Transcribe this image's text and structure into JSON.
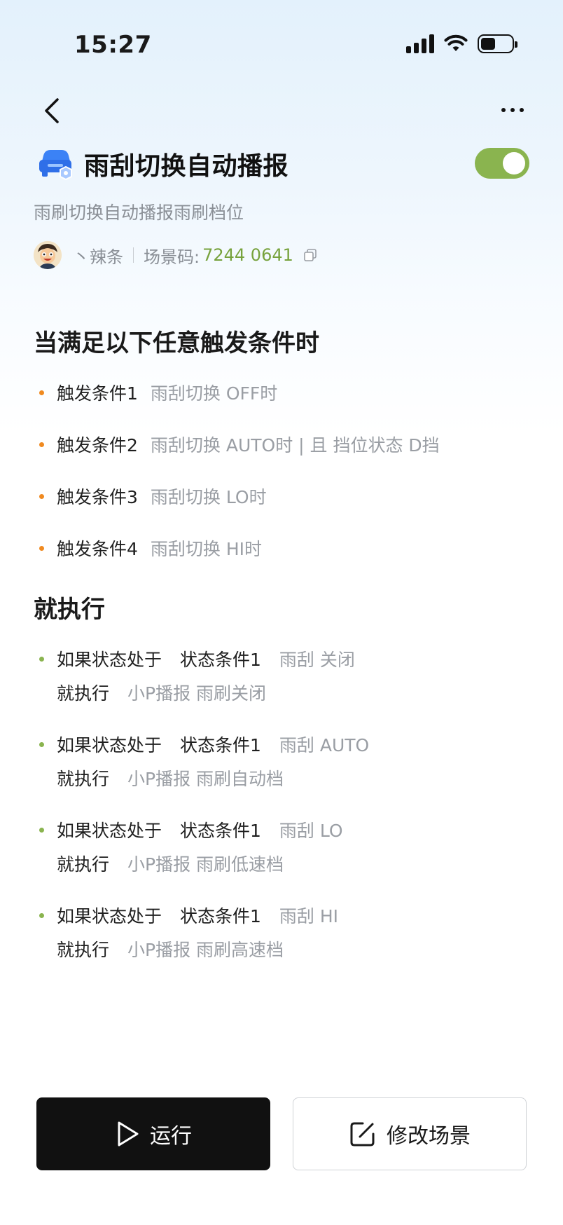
{
  "status_bar": {
    "time": "15:27"
  },
  "header": {
    "title": "雨刮切换自动播报",
    "subtitle": "雨刷切换自动播报雨刷档位",
    "toggle_on": true,
    "author": "丶辣条",
    "scene_code_label": "场景码:",
    "scene_code": "7244 0641"
  },
  "triggers": {
    "title": "当满足以下任意触发条件时",
    "items": [
      {
        "label": "触发条件1",
        "detail": "雨刮切换 OFF时"
      },
      {
        "label": "触发条件2",
        "detail": "雨刮切换 AUTO时 | 且 挡位状态 D挡"
      },
      {
        "label": "触发条件3",
        "detail": "雨刮切换 LO时"
      },
      {
        "label": "触发条件4",
        "detail": "雨刮切换 HI时"
      }
    ]
  },
  "actions": {
    "title": "就执行",
    "items": [
      {
        "if_label": "如果状态处于",
        "cond_label": "状态条件1",
        "cond_detail": "雨刮 关闭",
        "then_label": "就执行",
        "then_detail": "小P播报 雨刷关闭"
      },
      {
        "if_label": "如果状态处于",
        "cond_label": "状态条件1",
        "cond_detail": "雨刮 AUTO",
        "then_label": "就执行",
        "then_detail": "小P播报 雨刷自动档"
      },
      {
        "if_label": "如果状态处于",
        "cond_label": "状态条件1",
        "cond_detail": "雨刮 LO",
        "then_label": "就执行",
        "then_detail": "小P播报 雨刷低速档"
      },
      {
        "if_label": "如果状态处于",
        "cond_label": "状态条件1",
        "cond_detail": "雨刮 HI",
        "then_label": "就执行",
        "then_detail": "小P播报 雨刷高速档"
      }
    ]
  },
  "buttons": {
    "run": "运行",
    "edit": "修改场景"
  },
  "colors": {
    "accent_green": "#8ab44f",
    "code_green": "#77a23c",
    "trigger_dot": "#f08a20",
    "primary_button": "#111111"
  }
}
